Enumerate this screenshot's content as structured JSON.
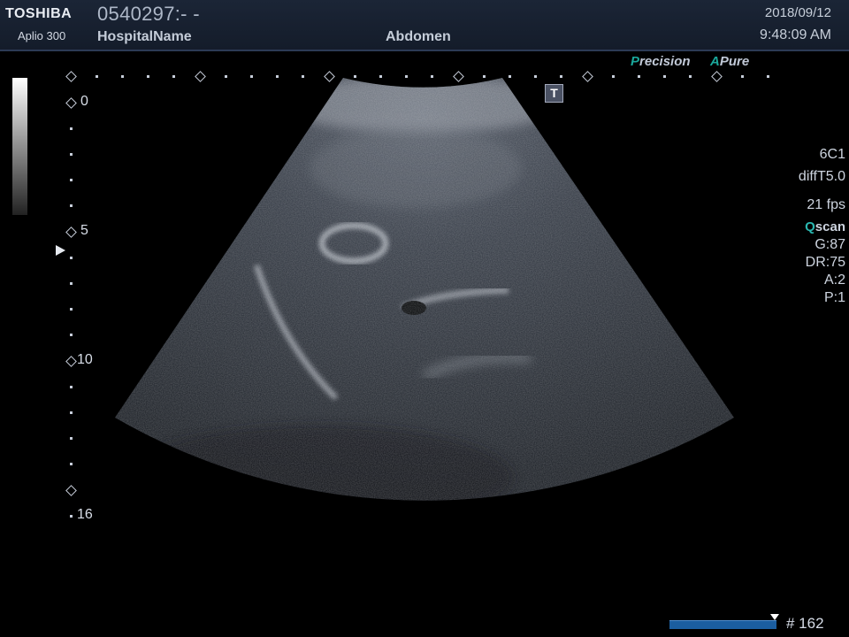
{
  "header": {
    "brand": "TOSHIBA",
    "model": "Aplio 300",
    "patient_id": "0540297:- -",
    "hospital": "HospitalName",
    "preset": "Abdomen",
    "date": "2018/09/12",
    "time": "9:48:09 AM"
  },
  "tags": [
    {
      "lead": "P",
      "rest": "recision"
    },
    {
      "lead": "A",
      "rest": "Pure"
    }
  ],
  "t_marker": "T",
  "depth_scale": {
    "labels": [
      "0",
      "5",
      "10",
      "16"
    ],
    "unit_steps": 16
  },
  "right_panel": {
    "probe": "6C1",
    "mode": "diffT5.0",
    "fps": "21 fps",
    "qscan_lead": "Q",
    "qscan_rest": "scan",
    "gain": "G:87",
    "dynamic_range": "DR:75",
    "a": "A:2",
    "p": "P:1"
  },
  "cine": {
    "progress": 1.0,
    "frame_label": "# 162"
  }
}
